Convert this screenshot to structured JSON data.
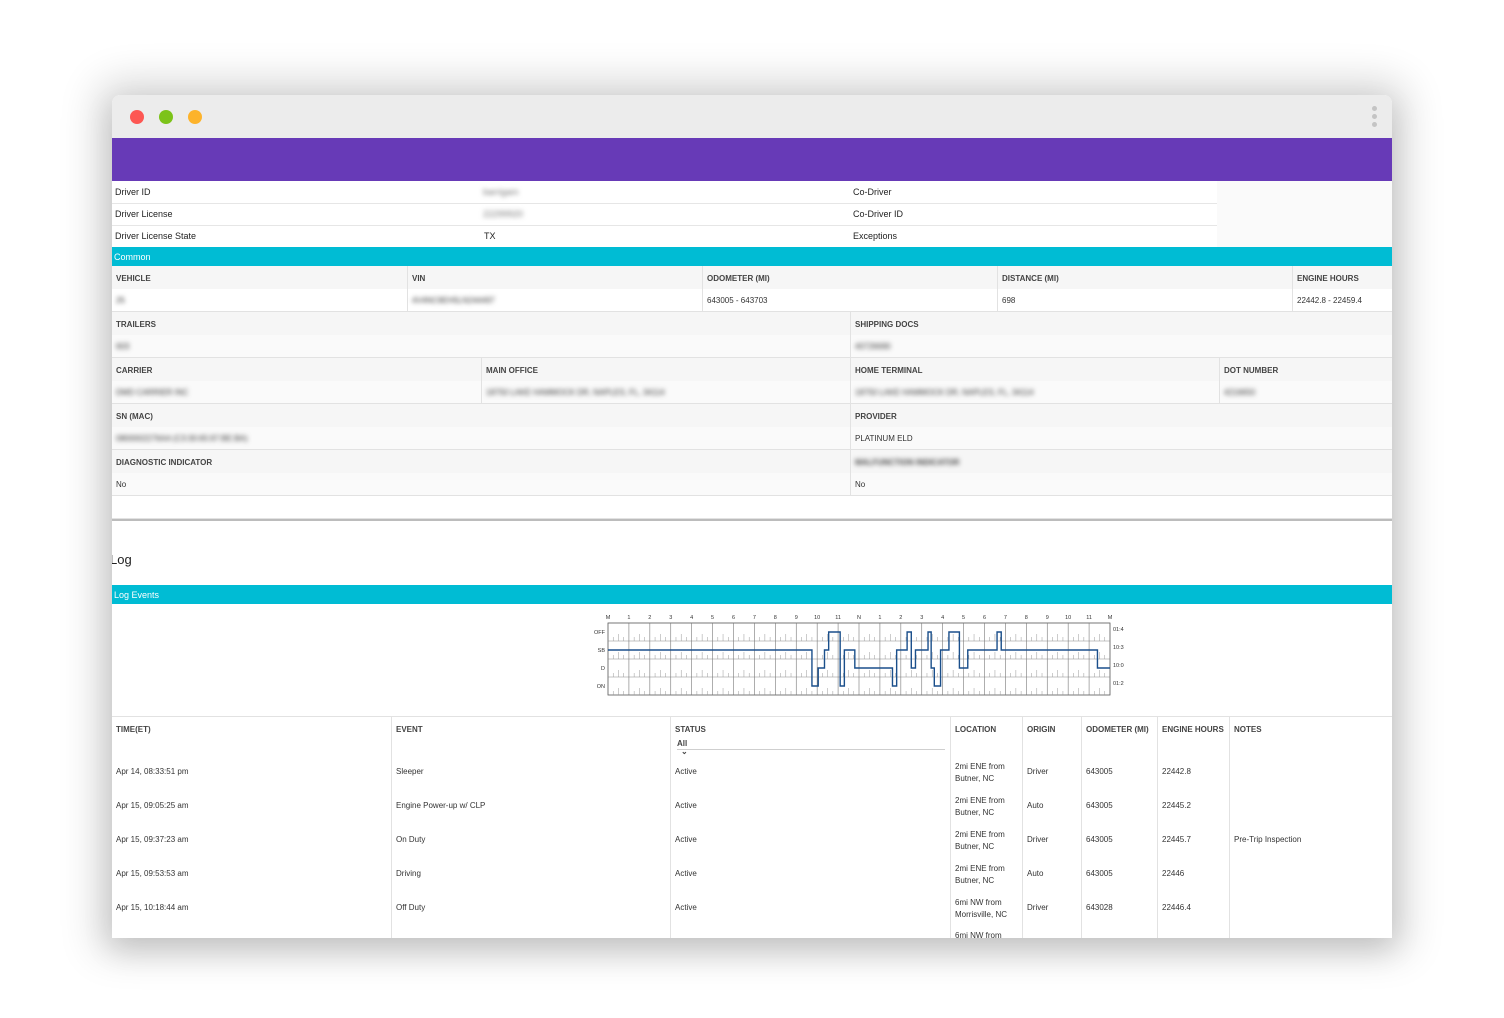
{
  "driver_info": {
    "rows": [
      {
        "label": "Driver ID",
        "value": "barrigam",
        "right_label": "Co-Driver"
      },
      {
        "label": "Driver License",
        "value": "22299920",
        "right_label": "Co-Driver ID"
      },
      {
        "label": "Driver License State",
        "value": "TX",
        "right_label": "Exceptions"
      }
    ]
  },
  "common": {
    "title": "Common",
    "vehicle_headers": [
      "VEHICLE",
      "VIN",
      "ODOMETER (MI)",
      "DISTANCE (MI)",
      "ENGINE HOURS"
    ],
    "vehicle_values": [
      "25",
      "4V4NC9EH5LN244497",
      "643005 - 643703",
      "698",
      "22442.8 - 22459.4"
    ],
    "trailers_label": "TRAILERS",
    "trailers_value": "603",
    "shipping_docs_label": "SHIPPING DOCS",
    "shipping_docs_value": "40726690",
    "carrier_headers": [
      "CARRIER",
      "MAIN OFFICE",
      "HOME TERMINAL",
      "DOT NUMBER"
    ],
    "carrier_values": [
      "DMD CARRIER INC",
      "18750 LAKE HAMMOCK DR, NAPLES, FL, 34114",
      "18750 LAKE HAMMOCK DR, NAPLES, FL, 34114",
      "4216650"
    ],
    "sn_label": "SN (MAC)",
    "sn_value": "0800002276AA (C3:30:65:97:BE:BA)",
    "provider_label": "PROVIDER",
    "provider_value": "PLATINUM ELD",
    "diagnostic_label": "DIAGNOSTIC INDICATOR",
    "diagnostic_value": "No",
    "malfunction_label": "MALFUNCTION INDICATOR",
    "malfunction_value": "No"
  },
  "log": {
    "title": "Log",
    "events_title": "Log Events"
  },
  "chart_data": {
    "type": "line",
    "hour_labels": [
      "M",
      "1",
      "2",
      "3",
      "4",
      "5",
      "6",
      "7",
      "8",
      "9",
      "10",
      "11",
      "N",
      "1",
      "2",
      "3",
      "4",
      "5",
      "6",
      "7",
      "8",
      "9",
      "10",
      "11",
      "M"
    ],
    "status_rows": [
      "OFF",
      "SB",
      "D",
      "ON"
    ],
    "row_totals": [
      "01:46",
      "10:31",
      "10:04",
      "01:29"
    ],
    "series": [
      {
        "x_hours": [
          0,
          9.75,
          9.75,
          10.05,
          10.05,
          10.35,
          10.35,
          10.55,
          10.55,
          11.1,
          11.1,
          11.3,
          11.3,
          11.8,
          11.8,
          13.6,
          13.6,
          13.8,
          13.8,
          14.3,
          14.3,
          14.5,
          14.5,
          14.7,
          14.7,
          15.3,
          15.3,
          15.45,
          15.45,
          15.6,
          15.6,
          15.9,
          15.9,
          16.3,
          16.3,
          16.8,
          16.8,
          17.2,
          17.2,
          18.6,
          18.6,
          18.8,
          18.8,
          23.4,
          23.4,
          24
        ],
        "status": [
          "SB",
          "SB",
          "ON",
          "ON",
          "D",
          "D",
          "SB",
          "SB",
          "OFF",
          "OFF",
          "ON",
          "ON",
          "SB",
          "SB",
          "D",
          "D",
          "ON",
          "ON",
          "SB",
          "SB",
          "OFF",
          "OFF",
          "D",
          "D",
          "SB",
          "SB",
          "OFF",
          "OFF",
          "D",
          "D",
          "ON",
          "ON",
          "SB",
          "SB",
          "OFF",
          "OFF",
          "D",
          "D",
          "SB",
          "SB",
          "OFF",
          "OFF",
          "SB",
          "SB",
          "D",
          "D"
        ]
      }
    ]
  },
  "events": {
    "headers": [
      "TIME(ET)",
      "EVENT",
      "STATUS",
      "LOCATION",
      "ORIGIN",
      "ODOMETER (MI)",
      "ENGINE HOURS",
      "NOTES"
    ],
    "status_filter": "All",
    "rows": [
      {
        "time": "Apr 14, 08:33:51 pm",
        "event": "Sleeper",
        "status": "Active",
        "location": "2mi ENE from\nButner, NC",
        "origin": "Driver",
        "odometer": "643005",
        "engine_hours": "22442.8",
        "notes": ""
      },
      {
        "time": "Apr 15, 09:05:25 am",
        "event": "Engine Power-up w/ CLP",
        "status": "Active",
        "location": "2mi ENE from\nButner, NC",
        "origin": "Auto",
        "odometer": "643005",
        "engine_hours": "22445.2",
        "notes": ""
      },
      {
        "time": "Apr 15, 09:37:23 am",
        "event": "On Duty",
        "status": "Active",
        "location": "2mi ENE from\nButner, NC",
        "origin": "Driver",
        "odometer": "643005",
        "engine_hours": "22445.7",
        "notes": "Pre-Trip Inspection"
      },
      {
        "time": "Apr 15, 09:53:53 am",
        "event": "Driving",
        "status": "Active",
        "location": "2mi ENE from\nButner, NC",
        "origin": "Auto",
        "odometer": "643005",
        "engine_hours": "22446",
        "notes": ""
      },
      {
        "time": "Apr 15, 10:18:44 am",
        "event": "Off Duty",
        "status": "Active",
        "location": "6mi NW from\nMorrisville, NC",
        "origin": "Driver",
        "odometer": "643028",
        "engine_hours": "22446.4",
        "notes": ""
      },
      {
        "time": "",
        "event": "",
        "status": "",
        "location": "6mi NW from",
        "origin": "",
        "odometer": "",
        "engine_hours": "",
        "notes": ""
      }
    ]
  }
}
